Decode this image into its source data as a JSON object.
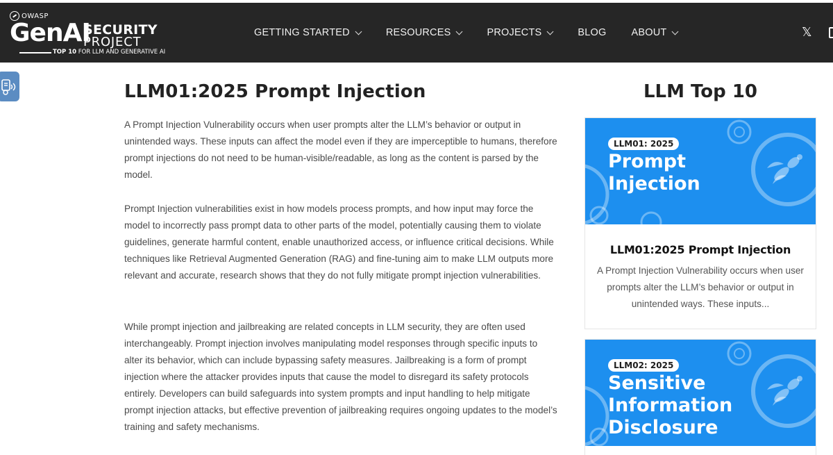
{
  "header": {
    "logo": {
      "owasp": "OWASP",
      "genai": "GenAI",
      "security": "SECURITY",
      "project": "PROJECT",
      "tagline_bold": "TOP 10",
      "tagline_rest": " FOR LLM AND GENERATIVE AI"
    },
    "nav": [
      {
        "label": "GETTING STARTED",
        "icon": "chevron-down-icon"
      },
      {
        "label": "RESOURCES",
        "icon": "chevron-down-icon"
      },
      {
        "label": "PROJECTS",
        "icon": "chevron-down-icon"
      },
      {
        "label": "BLOG"
      },
      {
        "label": "ABOUT",
        "icon": "chevron-down-icon"
      }
    ],
    "social": {
      "x_glyph": "𝕏",
      "x_icon": "x-twitter-icon"
    }
  },
  "accessibility_widget": {
    "icon": "accessibility-audio-icon",
    "color": "#5b8cc2"
  },
  "main": {
    "title": "LLM01:2025 Prompt Injection",
    "paragraphs": [
      "A Prompt Injection Vulnerability occurs when user prompts alter the LLM’s behavior or output in unintended ways. These inputs can affect the model even if they are imperceptible to humans, therefore prompt injections do not need to be human-visible/readable, as long as the content is parsed by the model.",
      "Prompt Injection vulnerabilities exist in how models process prompts, and how input may force the model to incorrectly pass prompt data to other parts of the model, potentially causing them to violate guidelines, generate harmful content, enable unauthorized access, or influence critical decisions. While techniques like Retrieval Augmented Generation (RAG) and fine-tuning aim to make LLM outputs more relevant and accurate, research shows that they do not fully mitigate prompt injection vulnerabilities.",
      "While prompt injection and jailbreaking are related concepts in LLM security, they are often used interchangeably. Prompt injection involves manipulating model responses through specific inputs to alter its behavior, which can include bypassing safety measures. Jailbreaking is a form of prompt injection where the attacker provides inputs that cause the model to disregard its safety protocols entirely. Developers can build safeguards into system prompts and input handling to help mitigate prompt injection attacks, but effective prevention of jailbreaking requires ongoing updates to the model’s training and safety mechanisms."
    ]
  },
  "sidebar": {
    "title": "LLM Top 10",
    "accent_color": "#1d8fef",
    "cards": [
      {
        "badge": "LLM01: 2025",
        "banner_lines": [
          "Prompt",
          "Injection"
        ],
        "heading": "LLM01:2025 Prompt Injection",
        "excerpt": "A Prompt Injection Vulnerability occurs when user prompts alter the LLM’s behavior or output in unintended ways. These inputs..."
      },
      {
        "badge": "LLM02: 2025",
        "banner_lines": [
          "Sensitive",
          "Information",
          "Disclosure"
        ]
      }
    ]
  }
}
